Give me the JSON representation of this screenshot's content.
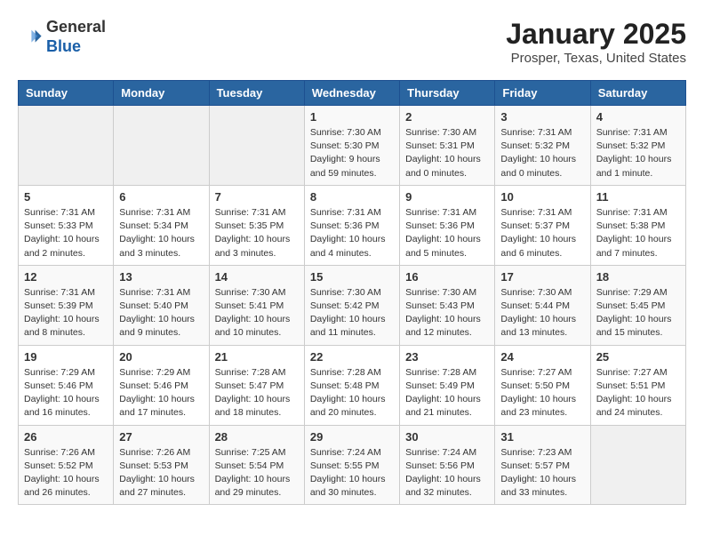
{
  "header": {
    "logo_line1": "General",
    "logo_line2": "Blue",
    "month": "January 2025",
    "location": "Prosper, Texas, United States"
  },
  "weekdays": [
    "Sunday",
    "Monday",
    "Tuesday",
    "Wednesday",
    "Thursday",
    "Friday",
    "Saturday"
  ],
  "weeks": [
    [
      {
        "day": "",
        "sunrise": "",
        "sunset": "",
        "daylight": "",
        "empty": true
      },
      {
        "day": "",
        "sunrise": "",
        "sunset": "",
        "daylight": "",
        "empty": true
      },
      {
        "day": "",
        "sunrise": "",
        "sunset": "",
        "daylight": "",
        "empty": true
      },
      {
        "day": "1",
        "sunrise": "Sunrise: 7:30 AM",
        "sunset": "Sunset: 5:30 PM",
        "daylight": "Daylight: 9 hours and 59 minutes."
      },
      {
        "day": "2",
        "sunrise": "Sunrise: 7:30 AM",
        "sunset": "Sunset: 5:31 PM",
        "daylight": "Daylight: 10 hours and 0 minutes."
      },
      {
        "day": "3",
        "sunrise": "Sunrise: 7:31 AM",
        "sunset": "Sunset: 5:32 PM",
        "daylight": "Daylight: 10 hours and 0 minutes."
      },
      {
        "day": "4",
        "sunrise": "Sunrise: 7:31 AM",
        "sunset": "Sunset: 5:32 PM",
        "daylight": "Daylight: 10 hours and 1 minute."
      }
    ],
    [
      {
        "day": "5",
        "sunrise": "Sunrise: 7:31 AM",
        "sunset": "Sunset: 5:33 PM",
        "daylight": "Daylight: 10 hours and 2 minutes."
      },
      {
        "day": "6",
        "sunrise": "Sunrise: 7:31 AM",
        "sunset": "Sunset: 5:34 PM",
        "daylight": "Daylight: 10 hours and 3 minutes."
      },
      {
        "day": "7",
        "sunrise": "Sunrise: 7:31 AM",
        "sunset": "Sunset: 5:35 PM",
        "daylight": "Daylight: 10 hours and 3 minutes."
      },
      {
        "day": "8",
        "sunrise": "Sunrise: 7:31 AM",
        "sunset": "Sunset: 5:36 PM",
        "daylight": "Daylight: 10 hours and 4 minutes."
      },
      {
        "day": "9",
        "sunrise": "Sunrise: 7:31 AM",
        "sunset": "Sunset: 5:36 PM",
        "daylight": "Daylight: 10 hours and 5 minutes."
      },
      {
        "day": "10",
        "sunrise": "Sunrise: 7:31 AM",
        "sunset": "Sunset: 5:37 PM",
        "daylight": "Daylight: 10 hours and 6 minutes."
      },
      {
        "day": "11",
        "sunrise": "Sunrise: 7:31 AM",
        "sunset": "Sunset: 5:38 PM",
        "daylight": "Daylight: 10 hours and 7 minutes."
      }
    ],
    [
      {
        "day": "12",
        "sunrise": "Sunrise: 7:31 AM",
        "sunset": "Sunset: 5:39 PM",
        "daylight": "Daylight: 10 hours and 8 minutes."
      },
      {
        "day": "13",
        "sunrise": "Sunrise: 7:31 AM",
        "sunset": "Sunset: 5:40 PM",
        "daylight": "Daylight: 10 hours and 9 minutes."
      },
      {
        "day": "14",
        "sunrise": "Sunrise: 7:30 AM",
        "sunset": "Sunset: 5:41 PM",
        "daylight": "Daylight: 10 hours and 10 minutes."
      },
      {
        "day": "15",
        "sunrise": "Sunrise: 7:30 AM",
        "sunset": "Sunset: 5:42 PM",
        "daylight": "Daylight: 10 hours and 11 minutes."
      },
      {
        "day": "16",
        "sunrise": "Sunrise: 7:30 AM",
        "sunset": "Sunset: 5:43 PM",
        "daylight": "Daylight: 10 hours and 12 minutes."
      },
      {
        "day": "17",
        "sunrise": "Sunrise: 7:30 AM",
        "sunset": "Sunset: 5:44 PM",
        "daylight": "Daylight: 10 hours and 13 minutes."
      },
      {
        "day": "18",
        "sunrise": "Sunrise: 7:29 AM",
        "sunset": "Sunset: 5:45 PM",
        "daylight": "Daylight: 10 hours and 15 minutes."
      }
    ],
    [
      {
        "day": "19",
        "sunrise": "Sunrise: 7:29 AM",
        "sunset": "Sunset: 5:46 PM",
        "daylight": "Daylight: 10 hours and 16 minutes."
      },
      {
        "day": "20",
        "sunrise": "Sunrise: 7:29 AM",
        "sunset": "Sunset: 5:46 PM",
        "daylight": "Daylight: 10 hours and 17 minutes."
      },
      {
        "day": "21",
        "sunrise": "Sunrise: 7:28 AM",
        "sunset": "Sunset: 5:47 PM",
        "daylight": "Daylight: 10 hours and 18 minutes."
      },
      {
        "day": "22",
        "sunrise": "Sunrise: 7:28 AM",
        "sunset": "Sunset: 5:48 PM",
        "daylight": "Daylight: 10 hours and 20 minutes."
      },
      {
        "day": "23",
        "sunrise": "Sunrise: 7:28 AM",
        "sunset": "Sunset: 5:49 PM",
        "daylight": "Daylight: 10 hours and 21 minutes."
      },
      {
        "day": "24",
        "sunrise": "Sunrise: 7:27 AM",
        "sunset": "Sunset: 5:50 PM",
        "daylight": "Daylight: 10 hours and 23 minutes."
      },
      {
        "day": "25",
        "sunrise": "Sunrise: 7:27 AM",
        "sunset": "Sunset: 5:51 PM",
        "daylight": "Daylight: 10 hours and 24 minutes."
      }
    ],
    [
      {
        "day": "26",
        "sunrise": "Sunrise: 7:26 AM",
        "sunset": "Sunset: 5:52 PM",
        "daylight": "Daylight: 10 hours and 26 minutes."
      },
      {
        "day": "27",
        "sunrise": "Sunrise: 7:26 AM",
        "sunset": "Sunset: 5:53 PM",
        "daylight": "Daylight: 10 hours and 27 minutes."
      },
      {
        "day": "28",
        "sunrise": "Sunrise: 7:25 AM",
        "sunset": "Sunset: 5:54 PM",
        "daylight": "Daylight: 10 hours and 29 minutes."
      },
      {
        "day": "29",
        "sunrise": "Sunrise: 7:24 AM",
        "sunset": "Sunset: 5:55 PM",
        "daylight": "Daylight: 10 hours and 30 minutes."
      },
      {
        "day": "30",
        "sunrise": "Sunrise: 7:24 AM",
        "sunset": "Sunset: 5:56 PM",
        "daylight": "Daylight: 10 hours and 32 minutes."
      },
      {
        "day": "31",
        "sunrise": "Sunrise: 7:23 AM",
        "sunset": "Sunset: 5:57 PM",
        "daylight": "Daylight: 10 hours and 33 minutes."
      },
      {
        "day": "",
        "sunrise": "",
        "sunset": "",
        "daylight": "",
        "empty": true
      }
    ]
  ]
}
